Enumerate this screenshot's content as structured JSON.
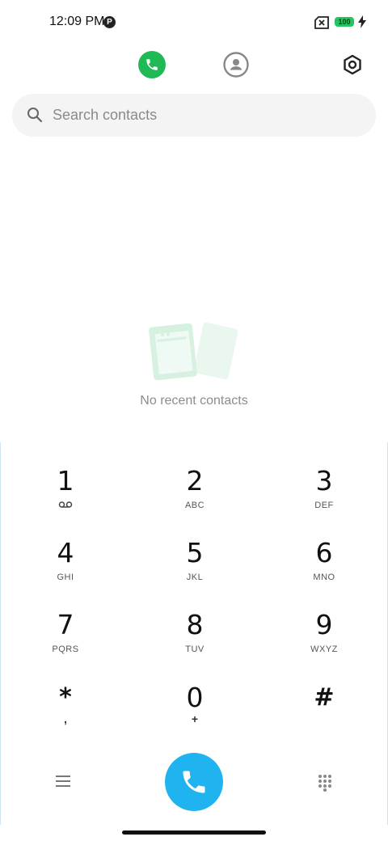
{
  "status_bar": {
    "time": "12:09 PM",
    "p_badge": "P",
    "battery": "100",
    "icons": [
      "p-icon",
      "no-sim-icon",
      "battery-icon",
      "charging-bolt-icon"
    ]
  },
  "tabs": {
    "icons": [
      "phone-icon",
      "contacts-icon",
      "settings-icon"
    ],
    "active": "calls",
    "active_color": "#1fba55"
  },
  "search": {
    "placeholder": "Search contacts",
    "value": ""
  },
  "empty_state": {
    "message": "No recent contacts",
    "icon": "recents-illustration"
  },
  "dialpad": {
    "keys": [
      {
        "digit": "1",
        "letters": "",
        "icon": "voicemail-icon"
      },
      {
        "digit": "2",
        "letters": "ABC"
      },
      {
        "digit": "3",
        "letters": "DEF"
      },
      {
        "digit": "4",
        "letters": "GHI"
      },
      {
        "digit": "5",
        "letters": "JKL"
      },
      {
        "digit": "6",
        "letters": "MNO"
      },
      {
        "digit": "7",
        "letters": "PQRS"
      },
      {
        "digit": "8",
        "letters": "TUV"
      },
      {
        "digit": "9",
        "letters": "WXYZ"
      },
      {
        "digit": "*",
        "letters": ","
      },
      {
        "digit": "0",
        "letters": "+"
      },
      {
        "digit": "#",
        "letters": ""
      }
    ],
    "call_button_color": "#1fb4f0",
    "bottom_icons": [
      "menu-icon",
      "call-icon",
      "dialpad-icon"
    ]
  }
}
